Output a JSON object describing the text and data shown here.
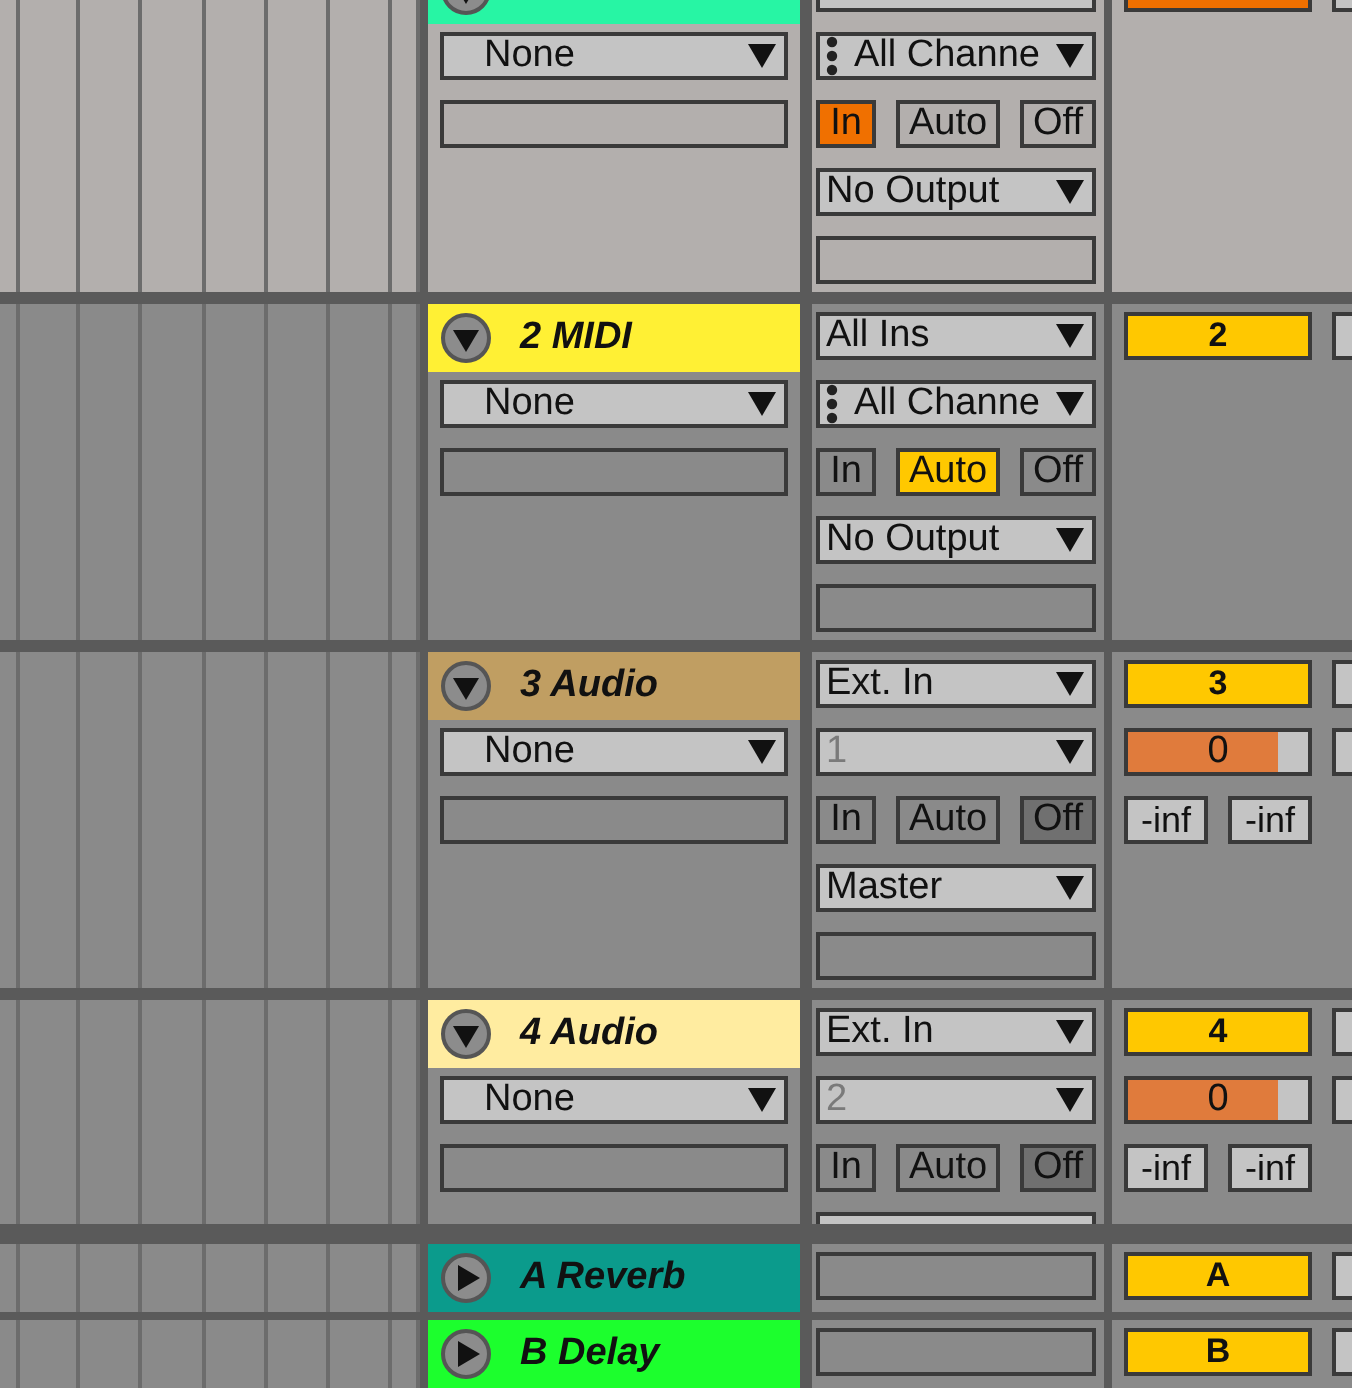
{
  "tracks": [
    {
      "kind": "midi",
      "selected": true,
      "expanded": true,
      "color": "#27f5a4",
      "instrument": "None",
      "input_channel": {
        "text": "All Channe",
        "disabled": false
      },
      "monitor": [
        {
          "kind": "in",
          "label": "In",
          "selected": true
        },
        {
          "kind": "auto",
          "label": "Auto",
          "selected": false
        },
        {
          "kind": "off",
          "label": "Off",
          "selected": false
        }
      ],
      "output": "No Output"
    },
    {
      "kind": "midi",
      "selected": false,
      "expanded": true,
      "color": "#fff034",
      "name": "2 MIDI",
      "instrument": "None",
      "input": "All Ins",
      "input_channel": {
        "text": "All Channe",
        "disabled": false
      },
      "monitor": [
        {
          "kind": "in",
          "label": "In",
          "selected": false
        },
        {
          "kind": "auto",
          "label": "Auto",
          "selected": true
        },
        {
          "kind": "off",
          "label": "Off",
          "selected": false
        }
      ],
      "output": "No Output",
      "number": "2"
    },
    {
      "kind": "audio",
      "selected": false,
      "expanded": true,
      "color": "#c09e62",
      "name": "3 Audio",
      "instrument": "None",
      "input": "Ext. In",
      "input_channel": {
        "text": "1",
        "disabled": true
      },
      "monitor": [
        {
          "kind": "in",
          "label": "In",
          "selected": false
        },
        {
          "kind": "auto",
          "label": "Auto",
          "selected": false
        },
        {
          "kind": "off",
          "label": "Off",
          "selected": true
        }
      ],
      "output": "Master",
      "number": "3",
      "volume": {
        "value": "0",
        "level": 0.83
      },
      "meters": [
        "-inf",
        "-inf"
      ]
    },
    {
      "kind": "audio",
      "selected": false,
      "expanded": true,
      "color": "#ffeca0",
      "name": "4 Audio",
      "instrument": "None",
      "input": "Ext. In",
      "input_channel": {
        "text": "2",
        "disabled": true
      },
      "monitor": [
        {
          "kind": "in",
          "label": "In",
          "selected": false
        },
        {
          "kind": "auto",
          "label": "Auto",
          "selected": false
        },
        {
          "kind": "off",
          "label": "Off",
          "selected": true
        }
      ],
      "number": "4",
      "volume": {
        "value": "0",
        "level": 0.83
      },
      "meters": [
        "-inf",
        "-inf"
      ]
    }
  ],
  "returns": [
    {
      "name": "A Reverb",
      "color": "#0b9b8c",
      "expanded": false,
      "number": "A"
    },
    {
      "name": "B Delay",
      "color": "#1cff2d",
      "expanded": false,
      "number": "B"
    }
  ]
}
